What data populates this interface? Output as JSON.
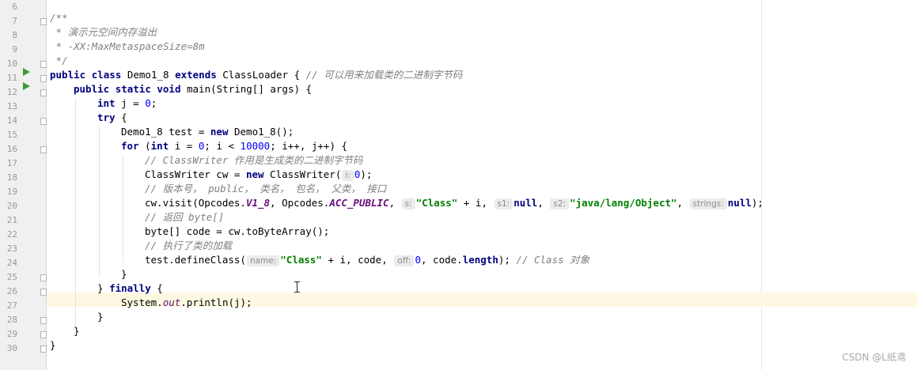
{
  "line_numbers": [
    "6",
    "7",
    "8",
    "9",
    "10",
    "11",
    "12",
    "13",
    "14",
    "15",
    "16",
    "17",
    "18",
    "19",
    "20",
    "21",
    "22",
    "23",
    "24",
    "25",
    "26",
    "27",
    "28",
    "29",
    "30"
  ],
  "code": {
    "l6": "/**",
    "l7": " * 演示元空间内存溢出",
    "l8": " * -XX:MaxMetaspaceSize=8m",
    "l9": " */",
    "l10_public": "public",
    "l10_class": "class",
    "l10_name": " Demo1_8 ",
    "l10_extends": "extends",
    "l10_rest": " ClassLoader { ",
    "l10_comment": "// 可以用来加载类的二进制字节码",
    "l11_public": "public",
    "l11_static": "static",
    "l11_void": "void",
    "l11_rest": " main(String[] args) {",
    "l12_int": "int",
    "l12_mid": " j = ",
    "l12_num": "0",
    "l12_end": ";",
    "l13_try": "try",
    "l13_rest": " {",
    "l14_a": "Demo1_8 test = ",
    "l14_new": "new",
    "l14_b": " Demo1_8();",
    "l15_for": "for",
    "l15_a": " (",
    "l15_int": "int",
    "l15_b": " i = ",
    "l15_n0": "0",
    "l15_c": "; i < ",
    "l15_n1": "10000",
    "l15_d": "; i++, j++) {",
    "l16": "// ClassWriter 作用是生成类的二进制字节码",
    "l17_a": "ClassWriter cw = ",
    "l17_new": "new",
    "l17_b": " ClassWriter(",
    "l17_hint": "i:",
    "l17_num": "0",
    "l17_end": ");",
    "l18": "// 版本号， public， 类名， 包名， 父类， 接口",
    "l19_a": "cw.visit(Opcodes.",
    "l19_v": "V1_8",
    "l19_b": ", Opcodes.",
    "l19_acc": "ACC_PUBLIC",
    "l19_c": ", ",
    "l19_h1": "s:",
    "l19_s1": "\"Class\"",
    "l19_d": " + i, ",
    "l19_h2": "s1:",
    "l19_null1": "null",
    "l19_e": ", ",
    "l19_h3": "s2:",
    "l19_s2": "\"java/lang/Object\"",
    "l19_f": ", ",
    "l19_h4": "strings:",
    "l19_null2": "null",
    "l19_g": ");",
    "l20": "// 返回 byte[]",
    "l21": "byte[] code = cw.toByteArray();",
    "l22": "// 执行了类的加载",
    "l23_a": "test.defineClass(",
    "l23_h1": "name:",
    "l23_s": "\"Class\"",
    "l23_b": " + i, code, ",
    "l23_h2": "off:",
    "l23_num": "0",
    "l23_c": ", code.",
    "l23_len": "length",
    "l23_d": "); ",
    "l23_comment": "// Class 对象",
    "l24": "}",
    "l25_a": "} ",
    "l25_finally": "finally",
    "l25_b": " {",
    "l26_a": "System.",
    "l26_out": "out",
    "l26_b": ".println(j);",
    "l27": "}",
    "l28": "}",
    "l29": "}"
  },
  "watermark": "CSDN @L纸鸢",
  "colors": {
    "keyword": "#000080",
    "number": "#0000ff",
    "string": "#008000",
    "comment": "#808080",
    "static_field": "#660e7a",
    "current_line": "#fdf8e1",
    "run_icon": "#3a9a3a"
  }
}
